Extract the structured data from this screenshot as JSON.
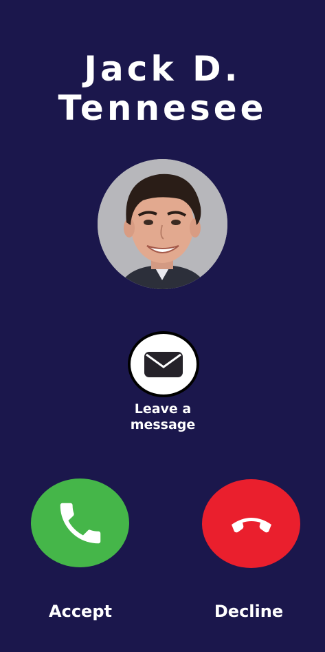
{
  "caller": {
    "first_line": "Jack D.",
    "second_line": "Tennesee"
  },
  "message_action": {
    "line1": "Leave a",
    "line2": "message",
    "icon": "envelope-icon"
  },
  "actions": {
    "accept_label": "Accept",
    "decline_label": "Decline",
    "accept_icon": "phone-icon",
    "decline_icon": "hang-up-icon"
  },
  "colors": {
    "background": "#1b174c",
    "accept": "#45b649",
    "decline": "#ea1f2d"
  }
}
